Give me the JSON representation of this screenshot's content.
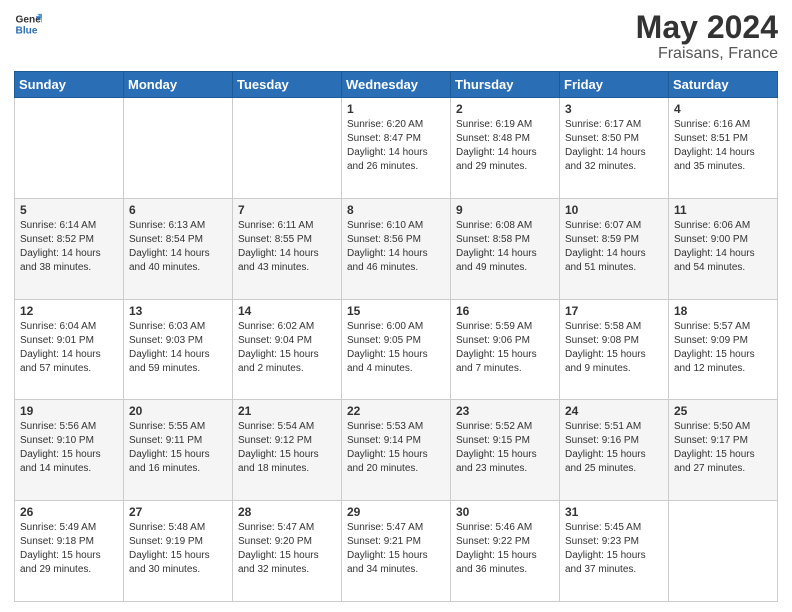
{
  "header": {
    "logo_line1": "General",
    "logo_line2": "Blue",
    "month": "May 2024",
    "location": "Fraisans, France"
  },
  "weekdays": [
    "Sunday",
    "Monday",
    "Tuesday",
    "Wednesday",
    "Thursday",
    "Friday",
    "Saturday"
  ],
  "weeks": [
    [
      {
        "day": "",
        "sunrise": "",
        "sunset": "",
        "daylight": ""
      },
      {
        "day": "",
        "sunrise": "",
        "sunset": "",
        "daylight": ""
      },
      {
        "day": "",
        "sunrise": "",
        "sunset": "",
        "daylight": ""
      },
      {
        "day": "1",
        "sunrise": "Sunrise: 6:20 AM",
        "sunset": "Sunset: 8:47 PM",
        "daylight": "Daylight: 14 hours and 26 minutes."
      },
      {
        "day": "2",
        "sunrise": "Sunrise: 6:19 AM",
        "sunset": "Sunset: 8:48 PM",
        "daylight": "Daylight: 14 hours and 29 minutes."
      },
      {
        "day": "3",
        "sunrise": "Sunrise: 6:17 AM",
        "sunset": "Sunset: 8:50 PM",
        "daylight": "Daylight: 14 hours and 32 minutes."
      },
      {
        "day": "4",
        "sunrise": "Sunrise: 6:16 AM",
        "sunset": "Sunset: 8:51 PM",
        "daylight": "Daylight: 14 hours and 35 minutes."
      }
    ],
    [
      {
        "day": "5",
        "sunrise": "Sunrise: 6:14 AM",
        "sunset": "Sunset: 8:52 PM",
        "daylight": "Daylight: 14 hours and 38 minutes."
      },
      {
        "day": "6",
        "sunrise": "Sunrise: 6:13 AM",
        "sunset": "Sunset: 8:54 PM",
        "daylight": "Daylight: 14 hours and 40 minutes."
      },
      {
        "day": "7",
        "sunrise": "Sunrise: 6:11 AM",
        "sunset": "Sunset: 8:55 PM",
        "daylight": "Daylight: 14 hours and 43 minutes."
      },
      {
        "day": "8",
        "sunrise": "Sunrise: 6:10 AM",
        "sunset": "Sunset: 8:56 PM",
        "daylight": "Daylight: 14 hours and 46 minutes."
      },
      {
        "day": "9",
        "sunrise": "Sunrise: 6:08 AM",
        "sunset": "Sunset: 8:58 PM",
        "daylight": "Daylight: 14 hours and 49 minutes."
      },
      {
        "day": "10",
        "sunrise": "Sunrise: 6:07 AM",
        "sunset": "Sunset: 8:59 PM",
        "daylight": "Daylight: 14 hours and 51 minutes."
      },
      {
        "day": "11",
        "sunrise": "Sunrise: 6:06 AM",
        "sunset": "Sunset: 9:00 PM",
        "daylight": "Daylight: 14 hours and 54 minutes."
      }
    ],
    [
      {
        "day": "12",
        "sunrise": "Sunrise: 6:04 AM",
        "sunset": "Sunset: 9:01 PM",
        "daylight": "Daylight: 14 hours and 57 minutes."
      },
      {
        "day": "13",
        "sunrise": "Sunrise: 6:03 AM",
        "sunset": "Sunset: 9:03 PM",
        "daylight": "Daylight: 14 hours and 59 minutes."
      },
      {
        "day": "14",
        "sunrise": "Sunrise: 6:02 AM",
        "sunset": "Sunset: 9:04 PM",
        "daylight": "Daylight: 15 hours and 2 minutes."
      },
      {
        "day": "15",
        "sunrise": "Sunrise: 6:00 AM",
        "sunset": "Sunset: 9:05 PM",
        "daylight": "Daylight: 15 hours and 4 minutes."
      },
      {
        "day": "16",
        "sunrise": "Sunrise: 5:59 AM",
        "sunset": "Sunset: 9:06 PM",
        "daylight": "Daylight: 15 hours and 7 minutes."
      },
      {
        "day": "17",
        "sunrise": "Sunrise: 5:58 AM",
        "sunset": "Sunset: 9:08 PM",
        "daylight": "Daylight: 15 hours and 9 minutes."
      },
      {
        "day": "18",
        "sunrise": "Sunrise: 5:57 AM",
        "sunset": "Sunset: 9:09 PM",
        "daylight": "Daylight: 15 hours and 12 minutes."
      }
    ],
    [
      {
        "day": "19",
        "sunrise": "Sunrise: 5:56 AM",
        "sunset": "Sunset: 9:10 PM",
        "daylight": "Daylight: 15 hours and 14 minutes."
      },
      {
        "day": "20",
        "sunrise": "Sunrise: 5:55 AM",
        "sunset": "Sunset: 9:11 PM",
        "daylight": "Daylight: 15 hours and 16 minutes."
      },
      {
        "day": "21",
        "sunrise": "Sunrise: 5:54 AM",
        "sunset": "Sunset: 9:12 PM",
        "daylight": "Daylight: 15 hours and 18 minutes."
      },
      {
        "day": "22",
        "sunrise": "Sunrise: 5:53 AM",
        "sunset": "Sunset: 9:14 PM",
        "daylight": "Daylight: 15 hours and 20 minutes."
      },
      {
        "day": "23",
        "sunrise": "Sunrise: 5:52 AM",
        "sunset": "Sunset: 9:15 PM",
        "daylight": "Daylight: 15 hours and 23 minutes."
      },
      {
        "day": "24",
        "sunrise": "Sunrise: 5:51 AM",
        "sunset": "Sunset: 9:16 PM",
        "daylight": "Daylight: 15 hours and 25 minutes."
      },
      {
        "day": "25",
        "sunrise": "Sunrise: 5:50 AM",
        "sunset": "Sunset: 9:17 PM",
        "daylight": "Daylight: 15 hours and 27 minutes."
      }
    ],
    [
      {
        "day": "26",
        "sunrise": "Sunrise: 5:49 AM",
        "sunset": "Sunset: 9:18 PM",
        "daylight": "Daylight: 15 hours and 29 minutes."
      },
      {
        "day": "27",
        "sunrise": "Sunrise: 5:48 AM",
        "sunset": "Sunset: 9:19 PM",
        "daylight": "Daylight: 15 hours and 30 minutes."
      },
      {
        "day": "28",
        "sunrise": "Sunrise: 5:47 AM",
        "sunset": "Sunset: 9:20 PM",
        "daylight": "Daylight: 15 hours and 32 minutes."
      },
      {
        "day": "29",
        "sunrise": "Sunrise: 5:47 AM",
        "sunset": "Sunset: 9:21 PM",
        "daylight": "Daylight: 15 hours and 34 minutes."
      },
      {
        "day": "30",
        "sunrise": "Sunrise: 5:46 AM",
        "sunset": "Sunset: 9:22 PM",
        "daylight": "Daylight: 15 hours and 36 minutes."
      },
      {
        "day": "31",
        "sunrise": "Sunrise: 5:45 AM",
        "sunset": "Sunset: 9:23 PM",
        "daylight": "Daylight: 15 hours and 37 minutes."
      },
      {
        "day": "",
        "sunrise": "",
        "sunset": "",
        "daylight": ""
      }
    ]
  ]
}
